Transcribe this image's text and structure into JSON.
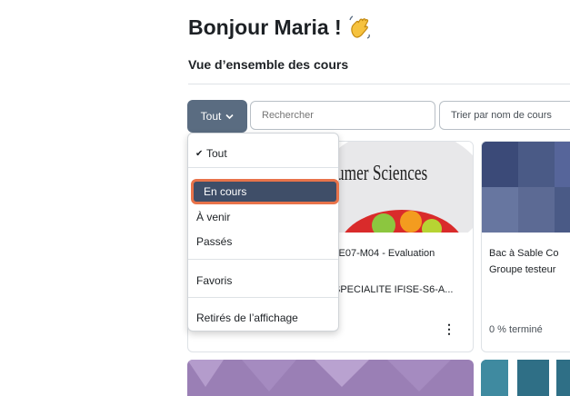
{
  "header": {
    "greeting": "Bonjour Maria !",
    "subtitle": "Vue d’ensemble des cours"
  },
  "toolbar": {
    "filter_label": "Tout",
    "search_placeholder": "Rechercher",
    "sort_label": "Trier par nom de cours"
  },
  "dropdown": {
    "items": {
      "all": "Tout",
      "in_progress": "En cours",
      "upcoming": "À venir",
      "past": "Passés",
      "favorites": "Favoris",
      "removed": "Retirés de l’affichage"
    },
    "selected": "all",
    "highlighted": "in_progress"
  },
  "courses": [
    {
      "image_text": "umer Sciences",
      "title": "JE07-M04 - Evaluation",
      "subtitle": "SPECIALITE IFISE-S6-A...",
      "menu_icon": "kebab-menu-icon"
    },
    {
      "title": "Bac à Sable Co",
      "subtitle": "Groupe testeur",
      "progress_text": "0 % terminé"
    }
  ],
  "colors": {
    "filter_button": "#5a6c81",
    "highlight_border": "#e8734a",
    "highlight_fill": "#3f4e68"
  }
}
